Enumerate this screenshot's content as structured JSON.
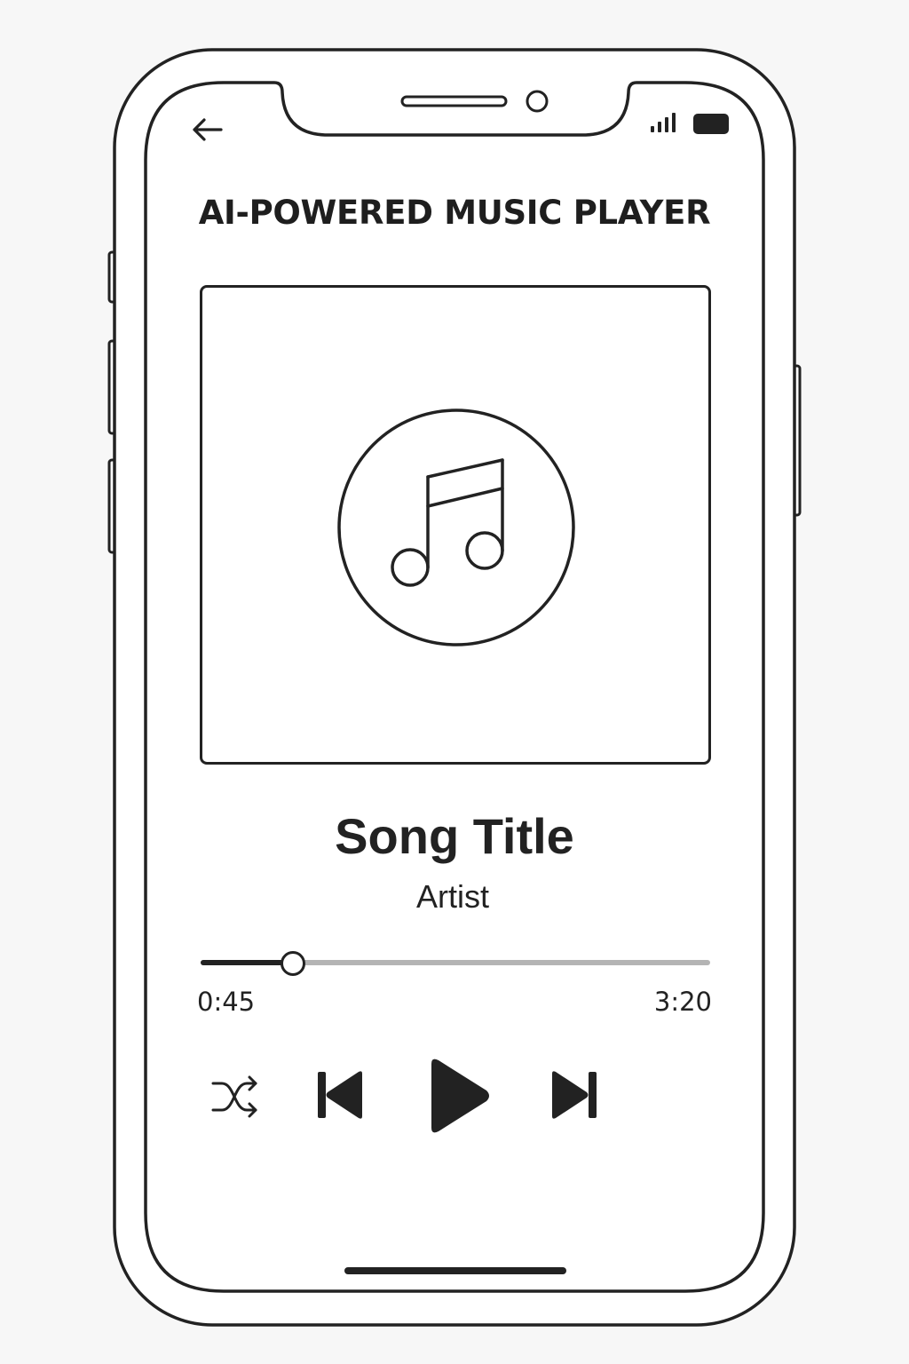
{
  "header": {
    "title": "AI-POWERED MUSIC PLAYER",
    "back_icon": "arrow-left-icon",
    "status_icons": [
      "signal-icon",
      "battery-icon"
    ]
  },
  "artwork": {
    "icon": "music-note-icon"
  },
  "track": {
    "title": "Song Title",
    "artist": "Artist",
    "elapsed": "0:45",
    "duration": "3:20",
    "progress_fraction": 0.18
  },
  "controls": {
    "icons": [
      "shuffle-icon",
      "skip-previous-icon",
      "play-icon",
      "skip-next-icon"
    ]
  },
  "colors": {
    "ink": "#222222",
    "track_inactive": "#b4b4b4",
    "screen": "#ffffff",
    "background": "#f7f7f7"
  }
}
